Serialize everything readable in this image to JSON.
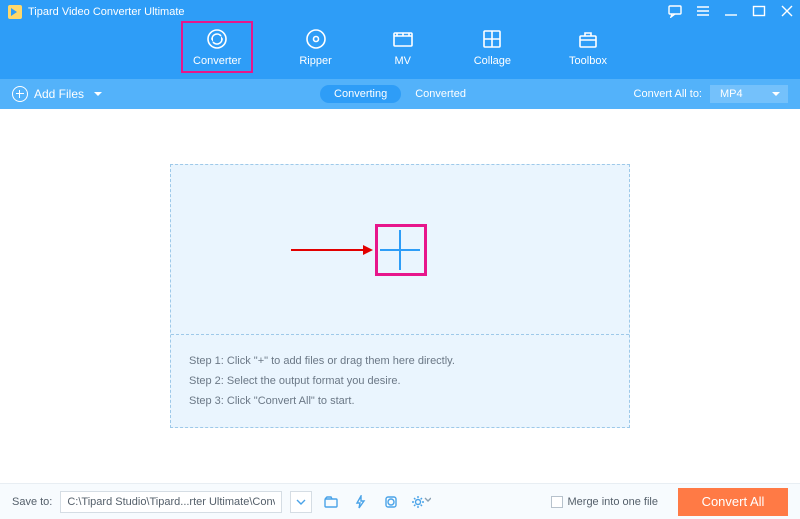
{
  "title": "Tipard Video Converter Ultimate",
  "nav": {
    "converter": "Converter",
    "ripper": "Ripper",
    "mv": "MV",
    "collage": "Collage",
    "toolbox": "Toolbox"
  },
  "subbar": {
    "add_files": "Add Files",
    "tab_converting": "Converting",
    "tab_converted": "Converted",
    "convert_all_to": "Convert All to:",
    "format": "MP4"
  },
  "steps": {
    "s1": "Step 1: Click \"+\" to add files or drag them here directly.",
    "s2": "Step 2: Select the output format you desire.",
    "s3": "Step 3: Click \"Convert All\" to start."
  },
  "footer": {
    "save_to": "Save to:",
    "path": "C:\\Tipard Studio\\Tipard...rter Ultimate\\Converted",
    "merge": "Merge into one file",
    "convert_all": "Convert All"
  }
}
